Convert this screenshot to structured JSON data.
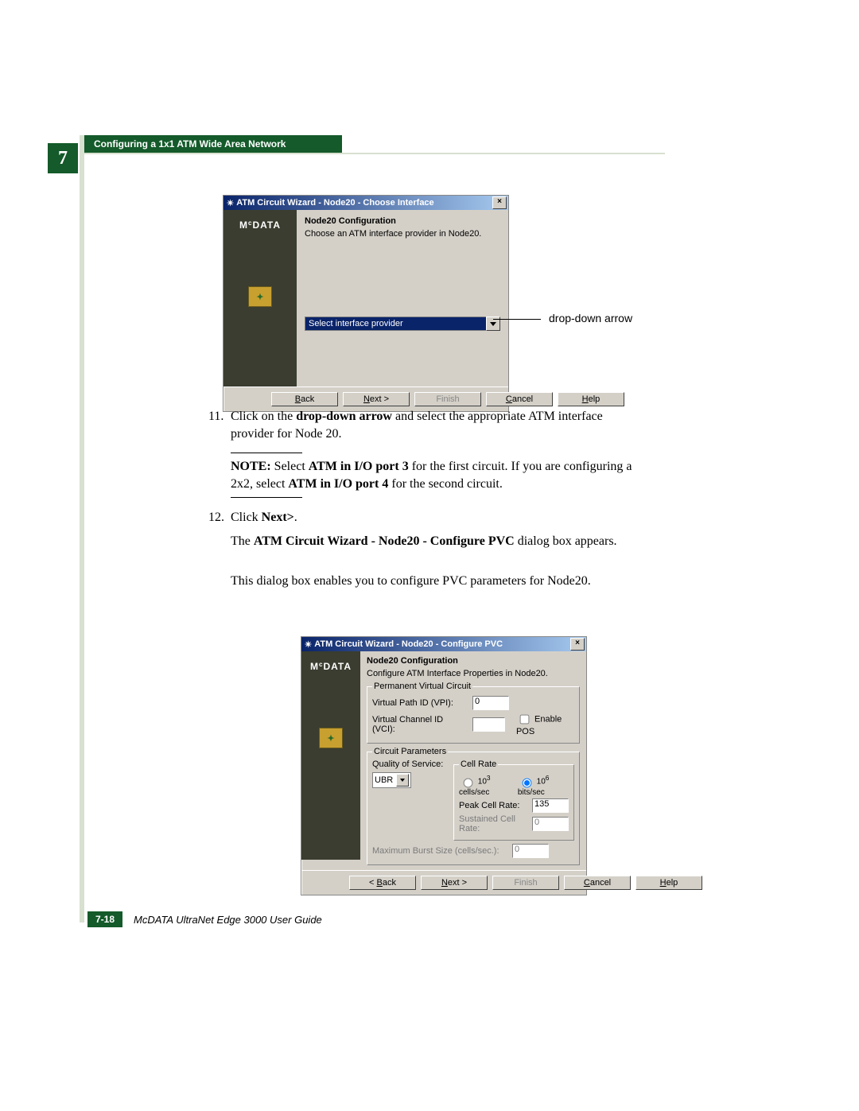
{
  "chapter_number": "7",
  "header_title": "Configuring a 1x1 ATM Wide Area Network",
  "dialog1": {
    "title": "ATM Circuit Wizard - Node20 - Choose Interface",
    "brand": "McDATA",
    "heading": "Node20 Configuration",
    "subtext": "Choose an ATM interface provider in Node20.",
    "dropdown_value": "Select interface provider",
    "buttons": {
      "back": "< Back",
      "next": "Next >",
      "finish": "Finish",
      "cancel": "Cancel",
      "help": "Help"
    }
  },
  "callout": "drop-down arrow",
  "step11_num": "11.",
  "step11_a": "Click on the ",
  "step11_b": "drop-down arrow",
  "step11_c": " and select the appropriate ATM interface provider for Node 20.",
  "note_label": "NOTE:",
  "note_a": " Select ",
  "note_b": "ATM in I/O port 3",
  "note_c": " for the first circuit. If you are configuring a 2x2, select ",
  "note_d": "ATM in I/O port 4",
  "note_e": " for the second circuit.",
  "step12_num": "12.",
  "step12_a": "Click ",
  "step12_b": "Next>",
  "step12_c": ".",
  "para2_a": "The ",
  "para2_b": "ATM Circuit Wizard - Node20 - Configure PVC",
  "para2_c": " dialog box appears.",
  "para3": "This dialog box enables you to configure PVC parameters for Node20.",
  "dialog2": {
    "title": "ATM Circuit Wizard - Node20 - Configure PVC",
    "brand": "McDATA",
    "heading": "Node20 Configuration",
    "subtext": "Configure ATM Interface Properties in Node20.",
    "pvc_legend": "Permanent Virtual Circuit",
    "vpi_label": "Virtual Path ID (VPI):",
    "vpi_value": "0",
    "vci_label": "Virtual Channel ID (VCI):",
    "vci_value": "",
    "enable_pos": "Enable POS",
    "cp_legend": "Circuit Parameters",
    "qos_label": "Quality of Service:",
    "qos_value": "UBR",
    "cellrate_legend": "Cell Rate",
    "cellrate_opt1_a": "10",
    "cellrate_opt1_sup": "3",
    "cellrate_opt1_b": " cells/sec",
    "cellrate_opt2_a": "10",
    "cellrate_opt2_sup": "6",
    "cellrate_opt2_b": " bits/sec",
    "peak_label": "Peak Cell Rate:",
    "peak_value": "135",
    "sustained_label": "Sustained Cell Rate:",
    "sustained_value": "0",
    "mbs_label": "Maximum Burst Size (cells/sec.):",
    "mbs_value": "0",
    "buttons": {
      "back": "< Back",
      "next": "Next >",
      "finish": "Finish",
      "cancel": "Cancel",
      "help": "Help"
    }
  },
  "footer": {
    "page": "7-18",
    "title": "McDATA UltraNet Edge 3000 User Guide"
  }
}
